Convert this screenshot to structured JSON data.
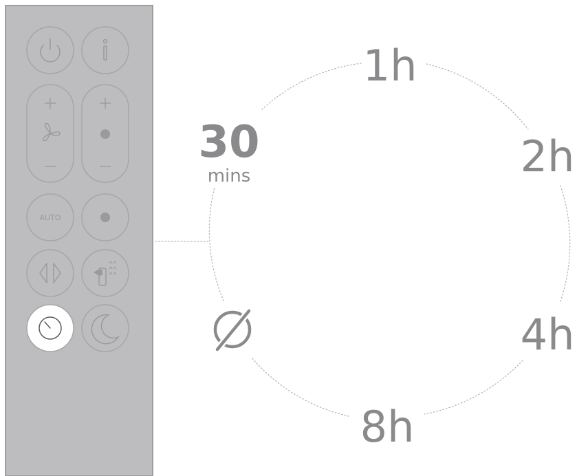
{
  "remote": {
    "auto_label": "AUTO"
  },
  "timer_options": {
    "half_hour_value": "30",
    "half_hour_unit": "mins",
    "one_hour": "1h",
    "two_hours": "2h",
    "four_hours": "4h",
    "eight_hours": "8h"
  },
  "icons": {
    "power": "power-icon",
    "info": "info-icon",
    "fan": "fan-icon",
    "dot": "dot-icon",
    "oscillation": "oscillation-icon",
    "airflow_direction": "airflow-direction-icon",
    "timer": "timer-icon",
    "night_mode": "moon-icon",
    "timer_off": "timer-off-icon"
  },
  "colors": {
    "remote_body": "#bdbdc0",
    "remote_border": "#9d9da0",
    "button_outline": "#a6a6a9",
    "button_glyph": "#9a9a9d",
    "active_button_fill": "#ffffff",
    "active_glyph": "#5a5a5c",
    "label_color": "#8a8a8c",
    "dotted_line": "#b0b0b2"
  }
}
